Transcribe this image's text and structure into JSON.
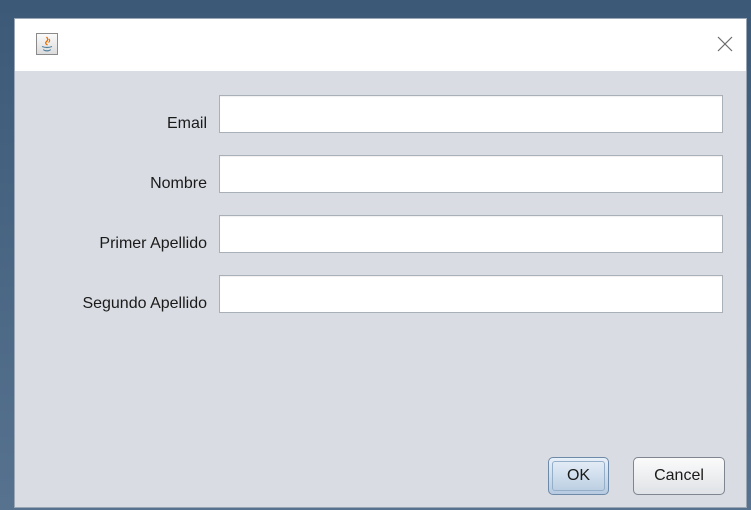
{
  "window": {
    "title": "",
    "icon": "java-coffee-cup-icon",
    "close_icon": "close-icon"
  },
  "form": {
    "fields": [
      {
        "label": "Email",
        "value": "",
        "placeholder": ""
      },
      {
        "label": "Nombre",
        "value": "",
        "placeholder": ""
      },
      {
        "label": "Primer Apellido",
        "value": "",
        "placeholder": ""
      },
      {
        "label": "Segundo Apellido",
        "value": "",
        "placeholder": ""
      }
    ]
  },
  "buttons": {
    "ok_label": "OK",
    "cancel_label": "Cancel"
  },
  "colors": {
    "window_background": "#d9dde3",
    "titlebar_background": "#ffffff",
    "desktop_background": "#4a6784",
    "ok_button_accent": "#b7cbe0"
  }
}
